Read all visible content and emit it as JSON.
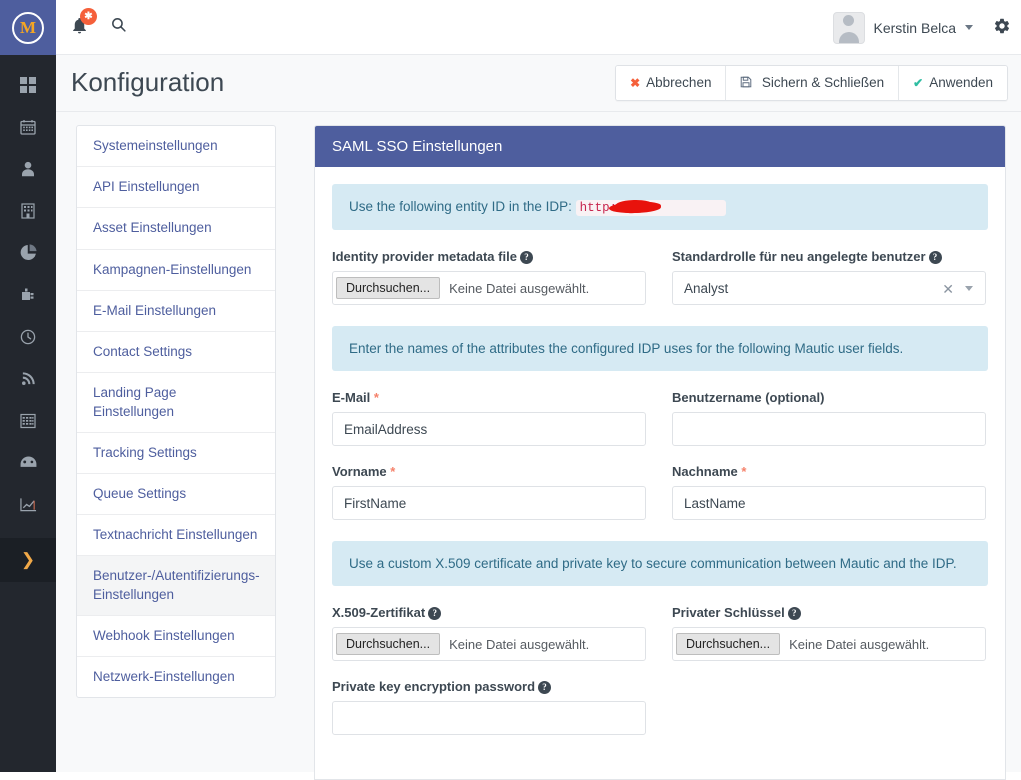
{
  "topbar": {
    "logo_letter": "M",
    "notification_badge": "✱",
    "user_name": "Kerstin Belca",
    "icons": {
      "bell": "bell-icon",
      "search": "search-icon",
      "gear": "gear-icon"
    }
  },
  "rail": {
    "items": [
      {
        "name": "dashboard",
        "glyph": "▦"
      },
      {
        "name": "calendar",
        "glyph": "▤"
      },
      {
        "name": "contacts",
        "glyph": "👤"
      },
      {
        "name": "companies",
        "glyph": "🏢"
      },
      {
        "name": "segments",
        "glyph": "◕"
      },
      {
        "name": "plugins",
        "glyph": "⚙"
      },
      {
        "name": "points",
        "glyph": "◷"
      },
      {
        "name": "stages",
        "glyph": "))"
      },
      {
        "name": "forms",
        "glyph": "▦"
      },
      {
        "name": "reports",
        "glyph": "◔"
      },
      {
        "name": "analytics",
        "glyph": "📈"
      }
    ],
    "expand_glyph": "❯"
  },
  "page": {
    "title": "Konfiguration",
    "actions": [
      {
        "label": "Abbrechen",
        "icon": "✖",
        "icon_class": "gl-x",
        "name": "cancel-button"
      },
      {
        "label": "Sichern & Schließen",
        "icon": "💾",
        "icon_class": "gl-save",
        "name": "save-and-close-button"
      },
      {
        "label": "Anwenden",
        "icon": "✔",
        "icon_class": "gl-check",
        "name": "apply-button"
      }
    ]
  },
  "sidebar": {
    "items": [
      {
        "label": "Systemeinstellungen",
        "active": false
      },
      {
        "label": "API Einstellungen",
        "active": false
      },
      {
        "label": "Asset Einstellungen",
        "active": false
      },
      {
        "label": "Kampagnen-Einstellungen",
        "active": false
      },
      {
        "label": "E-Mail Einstellungen",
        "active": false
      },
      {
        "label": "Contact Settings",
        "active": false
      },
      {
        "label": "Landing Page Einstellungen",
        "active": false
      },
      {
        "label": "Tracking Settings",
        "active": false
      },
      {
        "label": "Queue Settings",
        "active": false
      },
      {
        "label": "Textnachricht Einstellungen",
        "active": false
      },
      {
        "label": "Benutzer-/Autentifizierungs-Einstellungen",
        "active": true
      },
      {
        "label": "Webhook Einstellungen",
        "active": false
      },
      {
        "label": "Netzwerk-Einstellungen",
        "active": false
      }
    ]
  },
  "panel": {
    "title": "SAML SSO Einstellungen",
    "alert_entity": {
      "text": "Use the following entity ID in the IDP:",
      "code_visible": "http:/",
      "redacted": true
    },
    "alert_attributes": "Enter the names of the attributes the configured IDP uses for the following Mautic user fields.",
    "alert_cert": "Use a custom X.509 certificate and private key to secure communication between Mautic and the IDP.",
    "fields": {
      "metadata_file": {
        "label": "Identity provider metadata file",
        "button": "Durchsuchen...",
        "status": "Keine Datei ausgewählt."
      },
      "default_role": {
        "label": "Standardrolle für neu angelegte benutzer",
        "value": "Analyst",
        "clear_glyph": "✕"
      },
      "email": {
        "label": "E-Mail",
        "required": "*",
        "value": "EmailAddress"
      },
      "username": {
        "label": "Benutzername (optional)",
        "value": ""
      },
      "firstname": {
        "label": "Vorname",
        "required": "*",
        "value": "FirstName"
      },
      "lastname": {
        "label": "Nachname",
        "required": "*",
        "value": "LastName"
      },
      "x509_cert": {
        "label": "X.509-Zertifikat",
        "button": "Durchsuchen...",
        "status": "Keine Datei ausgewählt."
      },
      "private_key": {
        "label": "Privater Schlüssel",
        "button": "Durchsuchen...",
        "status": "Keine Datei ausgewählt."
      },
      "key_password": {
        "label": "Private key encryption password",
        "value": ""
      }
    },
    "help_glyph": "?"
  },
  "colors": {
    "brand_indigo": "#4e5e9e",
    "rail_dark": "#23272e",
    "alert_info": "#d6eaf3",
    "accent_orange": "#f0a848",
    "danger": "#f5603b",
    "success": "#2fbda2"
  }
}
